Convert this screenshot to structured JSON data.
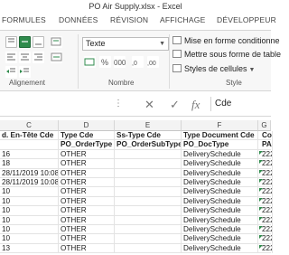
{
  "window": {
    "title": "PO Air Supply.xlsx - Excel"
  },
  "ribbon": {
    "tabs": [
      "FORMULES",
      "DONNÉES",
      "RÉVISION",
      "AFFICHAGE",
      "DÉVELOPPEUR"
    ],
    "groups": {
      "alignment": "Alignement",
      "number": "Nombre",
      "style": "Style"
    },
    "number_format": "Texte",
    "style_items": [
      "Mise en forme conditionne",
      "Mettre sous forme de table",
      "Styles de cellules"
    ],
    "colors": {
      "accent": "#217346",
      "fill_green": "#2f8b4c"
    }
  },
  "formula_bar": {
    "content": "Cde",
    "cancel": "✕",
    "enter": "✓",
    "fx": "fx"
  },
  "columns": [
    "C",
    "D",
    "E",
    "F",
    "G"
  ],
  "sheet": {
    "header_row": [
      "d. En-Tête Cde",
      "Type Cde",
      "Ss-Type Cde",
      "Type Document Cde",
      "Code"
    ],
    "sub_header_row": [
      "",
      "PO_OrderType",
      "PO_OrderSubType",
      "PO_DocType",
      "PAR"
    ],
    "rows": [
      [
        "16",
        "OTHER",
        "",
        "DeliverySchedule",
        "222"
      ],
      [
        "18",
        "OTHER",
        "",
        "DeliverySchedule",
        "222"
      ],
      [
        "28/11/2019 10:08",
        "OTHER",
        "",
        "DeliverySchedule",
        "222"
      ],
      [
        "28/11/2019 10:08",
        "OTHER",
        "",
        "DeliverySchedule",
        "222"
      ],
      [
        "10",
        "OTHER",
        "",
        "DeliverySchedule",
        "222"
      ],
      [
        "10",
        "OTHER",
        "",
        "DeliverySchedule",
        "222"
      ],
      [
        "10",
        "OTHER",
        "",
        "DeliverySchedule",
        "222"
      ],
      [
        "10",
        "OTHER",
        "",
        "DeliverySchedule",
        "222"
      ],
      [
        "10",
        "OTHER",
        "",
        "DeliverySchedule",
        "222"
      ],
      [
        "10",
        "OTHER",
        "",
        "DeliverySchedule",
        "222"
      ],
      [
        "13",
        "OTHER",
        "",
        "DeliverySchedule",
        "222"
      ]
    ]
  }
}
